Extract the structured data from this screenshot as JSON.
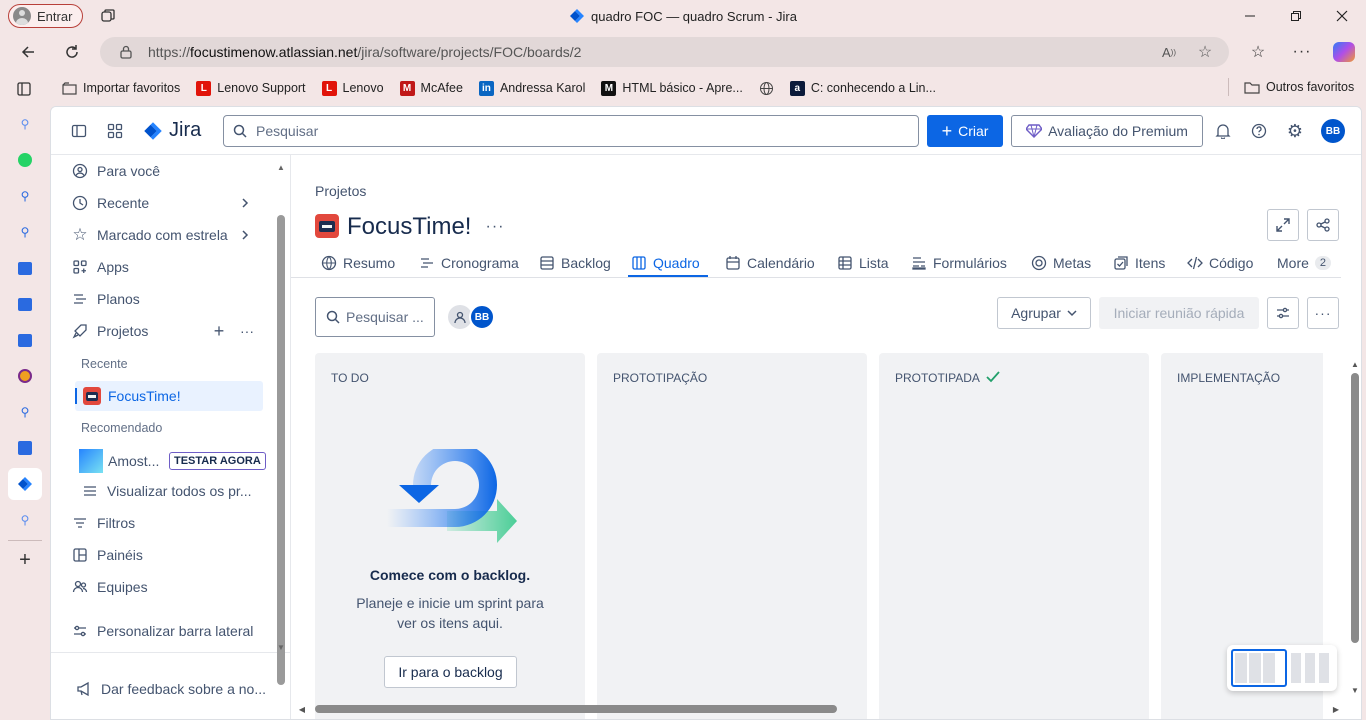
{
  "browser": {
    "profile_label": "Entrar",
    "window_title": "quadro FOC — quadro Scrum - Jira",
    "url_prefix": "https://",
    "url_host": "focustimenow.atlassian.net",
    "url_path": "/jira/software/projects/FOC/boards/2",
    "bookmarks": [
      "Importar favoritos",
      "Lenovo Support",
      "Lenovo",
      "McAfee",
      "Andressa Karol",
      "HTML básico - Apre...",
      "",
      "C: conhecendo a Lin..."
    ],
    "other_favorites": "Outros favoritos"
  },
  "jira": {
    "logo_text": "Jira",
    "search_placeholder": "Pesquisar",
    "create_label": "Criar",
    "premium_label": "Avaliação do Premium",
    "user_initials": "BB"
  },
  "sidebar": {
    "for_you": "Para você",
    "recent": "Recente",
    "starred": "Marcado com estrela",
    "apps": "Apps",
    "plans": "Planos",
    "projects": "Projetos",
    "recent_sub": "Recente",
    "project_name": "FocusTime!",
    "recommended_sub": "Recomendado",
    "sample_project": "Amost...",
    "try_now": "TESTAR AGORA",
    "view_all": "Visualizar todos os pr...",
    "filters": "Filtros",
    "dashboards": "Painéis",
    "teams": "Equipes",
    "customize": "Personalizar barra lateral",
    "feedback": "Dar feedback sobre a no..."
  },
  "main": {
    "breadcrumb": "Projetos",
    "project_title": "FocusTime!",
    "tabs": {
      "summary": "Resumo",
      "timeline": "Cronograma",
      "backlog": "Backlog",
      "board": "Quadro",
      "calendar": "Calendário",
      "list": "Lista",
      "forms": "Formulários",
      "goals": "Metas",
      "items": "Itens",
      "code": "Código",
      "more": "More",
      "more_count": "2"
    },
    "board_search_placeholder": "Pesquisar ...",
    "group_label": "Agrupar",
    "quick_meeting": "Iniciar reunião rápida",
    "columns": [
      "TO DO",
      "PROTOTIPAÇÃO",
      "PROTOTIPADA",
      "IMPLEMENTAÇÃO"
    ],
    "empty_title": "Comece com o backlog.",
    "empty_body_1": "Planeje e inicie um sprint para",
    "empty_body_2": "ver os itens aqui.",
    "go_backlog": "Ir para o backlog"
  },
  "colors": {
    "primary": "#0c66e4",
    "premium": "#6e5dc6",
    "avatar": "#0055cc"
  }
}
